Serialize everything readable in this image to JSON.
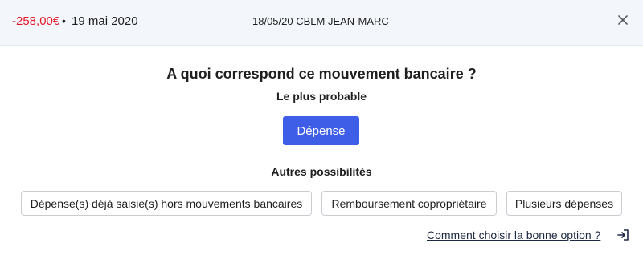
{
  "header": {
    "amount": "-258,00€",
    "bullet": "•",
    "date": "19 mai 2020",
    "label": "18/05/20 CBLM JEAN-MARC",
    "close_icon": "close-icon"
  },
  "main": {
    "title": "A quoi correspond ce mouvement bancaire ?",
    "most_probable_label": "Le plus probable",
    "primary_option": "Dépense",
    "others_label": "Autres possibilités",
    "options": [
      "Dépense(s) déjà saisie(s) hors mouvements bancaires",
      "Remboursement copropriétaire",
      "Plusieurs dépenses"
    ],
    "help_link": "Comment choisir la bonne option ?",
    "help_icon": "sign-in-icon"
  },
  "colors": {
    "amount": "#e0192b",
    "primary_button": "#3f5ee8",
    "header_bg": "#f3f6fa"
  }
}
